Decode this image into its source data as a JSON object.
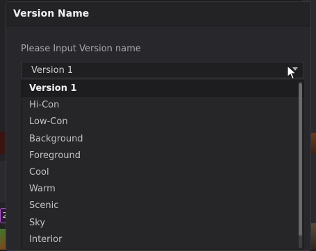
{
  "dialog": {
    "title": "Version Name",
    "prompt": "Please Input Version name",
    "combo_value": "Version 1"
  },
  "dropdown": {
    "options": [
      "Version 1",
      "Hi-Con",
      "Low-Con",
      "Background",
      "Foreground",
      "Cool",
      "Warm",
      "Scenic",
      "Sky",
      "Interior"
    ],
    "selected": "Version 1"
  },
  "background": {
    "badge": "2"
  },
  "colors": {
    "dialog_bg": "#28282c",
    "title_bg": "#232326",
    "dropdown_bg": "#262629",
    "selected_bg": "#1d1d20",
    "badge_border": "#b24fd1"
  }
}
